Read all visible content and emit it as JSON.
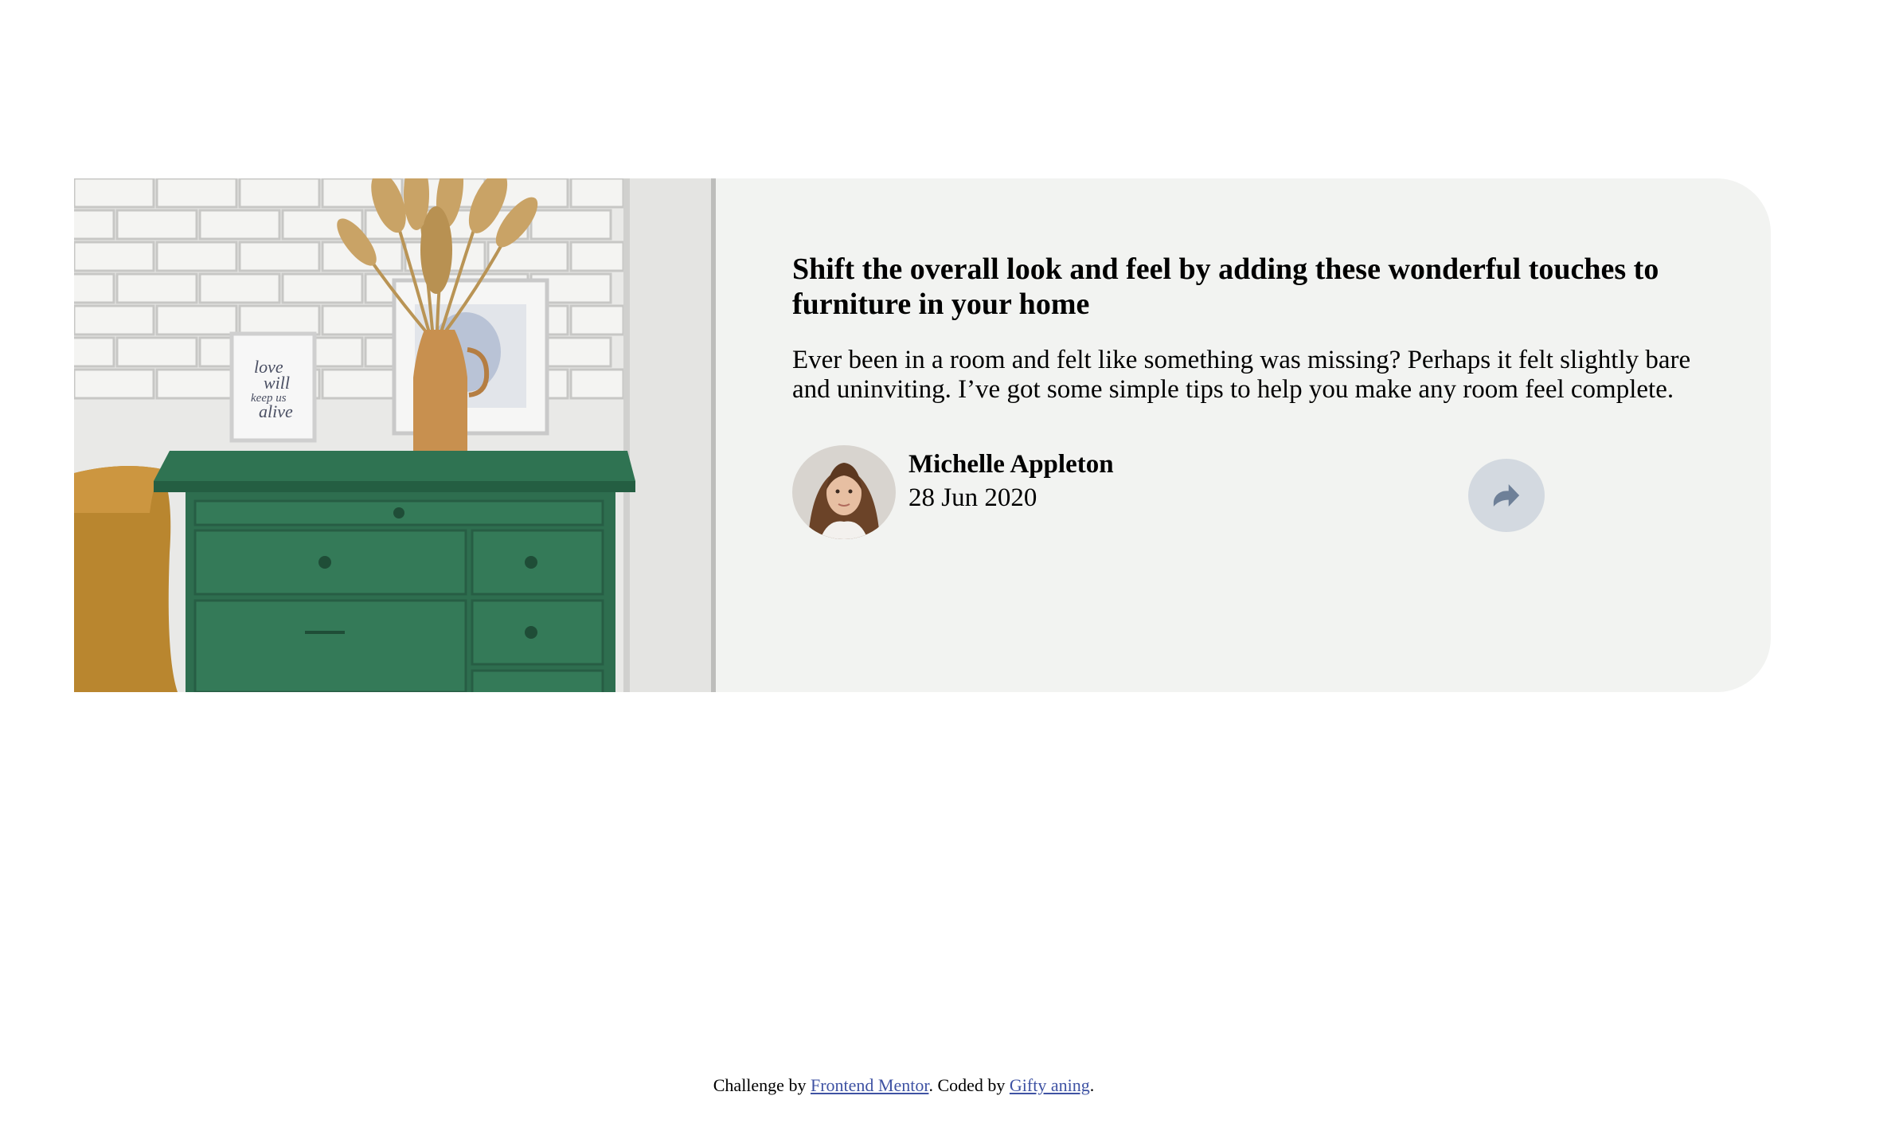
{
  "card": {
    "image_alt": "Green drawer with vase and frames",
    "frame_text": [
      "love",
      "will",
      "keep us",
      "alive"
    ],
    "title": "Shift the overall look and feel by adding these wonderful touches to furniture in your home",
    "description": "Ever been in a room and felt like something was missing? Perhaps it felt slightly bare and uninviting. I’ve got some simple tips to help you make any room feel complete.",
    "author": {
      "name": "Michelle Appleton",
      "date": "28 Jun 2020",
      "avatar_icon": "avatar-michelle"
    },
    "share": {
      "icon": "share-icon"
    }
  },
  "attribution": {
    "prefix": "Challenge by ",
    "link1": "Frontend Mentor",
    "middle": ". Coded by ",
    "link2": "Gifty aning",
    "suffix": "."
  },
  "colors": {
    "card_bg": "#f2f3f1",
    "share_bg": "#d3d9e0",
    "share_icon": "#6e8098",
    "link": "#3e52a3"
  }
}
